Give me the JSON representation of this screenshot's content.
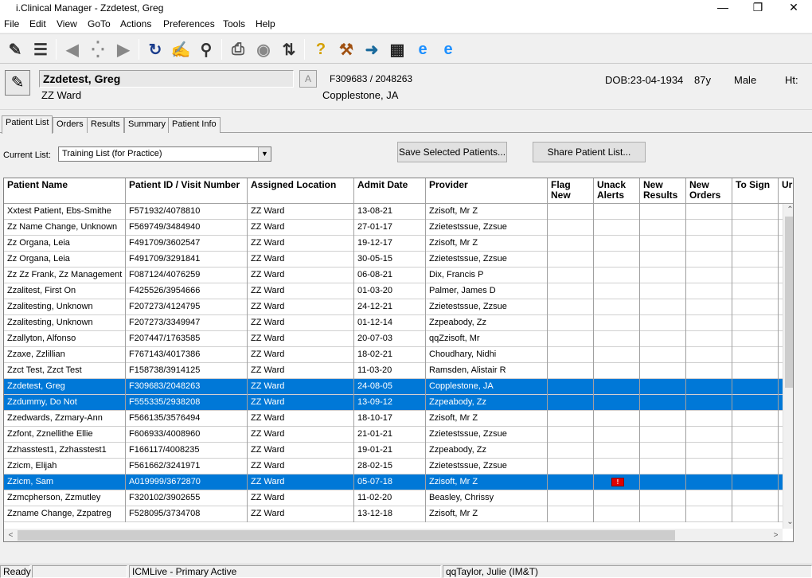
{
  "window": {
    "title": "i.Clinical Manager - Zzdetest, Greg"
  },
  "menu": [
    "File",
    "Edit",
    "View",
    "GoTo",
    "Actions",
    "Preferences",
    "Tools",
    "Help"
  ],
  "patient": {
    "name": "Zzdetest, Greg",
    "ward": "ZZ Ward",
    "alert_letter": "A",
    "id_visit": "F309683 / 2048263",
    "provider": "Copplestone, JA",
    "dob": "DOB:23-04-1934",
    "age": "87y",
    "sex": "Male",
    "ht": "Ht:"
  },
  "tabs": [
    "Patient List",
    "Orders",
    "Results",
    "Summary",
    "Patient Info"
  ],
  "current_list": {
    "label": "Current List:",
    "value": "Training List (for Practice)"
  },
  "buttons": {
    "save": "Save Selected Patients...",
    "share": "Share Patient List..."
  },
  "grid": {
    "columns": [
      "Patient Name",
      "Patient ID / Visit Number",
      "Assigned Location",
      "Admit Date",
      "Provider",
      "Flag New",
      "Unack Alerts",
      "New Results",
      "New Orders",
      "To Sign",
      "Ur"
    ],
    "rows": [
      {
        "name": "Xxtest Patient, Ebs-Smithe",
        "id": "F571932/4078810",
        "loc": "ZZ Ward",
        "date": "13-08-21",
        "prov": "Zzisoft, Mr Z"
      },
      {
        "name": "Zz Name Change, Unknown",
        "id": "F569749/3484940",
        "loc": "ZZ Ward",
        "date": "27-01-17",
        "prov": "Zzietestssue, Zzsue"
      },
      {
        "name": "Zz Organa, Leia",
        "id": "F491709/3602547",
        "loc": "ZZ Ward",
        "date": "19-12-17",
        "prov": "Zzisoft, Mr Z"
      },
      {
        "name": "Zz Organa, Leia",
        "id": "F491709/3291841",
        "loc": "ZZ Ward",
        "date": "30-05-15",
        "prov": "Zzietestssue, Zzsue"
      },
      {
        "name": "Zz Zz Frank, Zz Management",
        "id": "F087124/4076259",
        "loc": "ZZ Ward",
        "date": "06-08-21",
        "prov": "Dix, Francis P"
      },
      {
        "name": "Zzalitest, First On",
        "id": "F425526/3954666",
        "loc": "ZZ Ward",
        "date": "01-03-20",
        "prov": "Palmer, James D"
      },
      {
        "name": "Zzalitesting, Unknown",
        "id": "F207273/4124795",
        "loc": "ZZ Ward",
        "date": "24-12-21",
        "prov": "Zzietestssue, Zzsue"
      },
      {
        "name": "Zzalitesting, Unknown",
        "id": "F207273/3349947",
        "loc": "ZZ Ward",
        "date": "01-12-14",
        "prov": "Zzpeabody, Zz"
      },
      {
        "name": "Zzallyton, Alfonso",
        "id": "F207447/1763585",
        "loc": "ZZ Ward",
        "date": "20-07-03",
        "prov": "qqZzisoft, Mr"
      },
      {
        "name": "Zzaxe, Zzlillian",
        "id": "F767143/4017386",
        "loc": "ZZ Ward",
        "date": "18-02-21",
        "prov": "Choudhary, Nidhi"
      },
      {
        "name": "Zzct Test, Zzct Test",
        "id": "F158738/3914125",
        "loc": "ZZ Ward",
        "date": "11-03-20",
        "prov": "Ramsden, Alistair R"
      },
      {
        "name": "Zzdetest, Greg",
        "id": "F309683/2048263",
        "loc": "ZZ Ward",
        "date": "24-08-05",
        "prov": "Copplestone, JA"
      },
      {
        "name": "Zzdummy, Do Not",
        "id": "F555335/2938208",
        "loc": "ZZ Ward",
        "date": "13-09-12",
        "prov": "Zzpeabody, Zz"
      },
      {
        "name": "Zzedwards, Zzmary-Ann",
        "id": "F566135/3576494",
        "loc": "ZZ Ward",
        "date": "18-10-17",
        "prov": "Zzisoft, Mr Z"
      },
      {
        "name": "Zzfont, Zznellithe Ellie",
        "id": "F606933/4008960",
        "loc": "ZZ Ward",
        "date": "21-01-21",
        "prov": "Zzietestssue, Zzsue"
      },
      {
        "name": "Zzhasstest1, Zzhasstest1",
        "id": "F166117/4008235",
        "loc": "ZZ Ward",
        "date": "19-01-21",
        "prov": "Zzpeabody, Zz"
      },
      {
        "name": "Zzicm, Elijah",
        "id": "F561662/3241971",
        "loc": "ZZ Ward",
        "date": "28-02-15",
        "prov": "Zzietestssue, Zzsue"
      },
      {
        "name": "Zzicm, Sam",
        "id": "A019999/3672870",
        "loc": "ZZ Ward",
        "date": "05-07-18",
        "prov": "Zzisoft, Mr Z"
      },
      {
        "name": "Zzmcpherson, Zzmutley",
        "id": "F320102/3902655",
        "loc": "ZZ Ward",
        "date": "11-02-20",
        "prov": "Beasley, Chrissy"
      },
      {
        "name": "Zzname Change, Zzpatreg",
        "id": "F528095/3734708",
        "loc": "ZZ Ward",
        "date": "13-12-18",
        "prov": "Zzisoft, Mr Z"
      }
    ]
  },
  "alert_flag_text": "!",
  "colors": {
    "selection": "#0078d7",
    "alert": "#e00000"
  },
  "status": {
    "ready": "Ready",
    "server": "ICMLive - Primary Active",
    "user": "qqTaylor, Julie (IM&T)"
  }
}
